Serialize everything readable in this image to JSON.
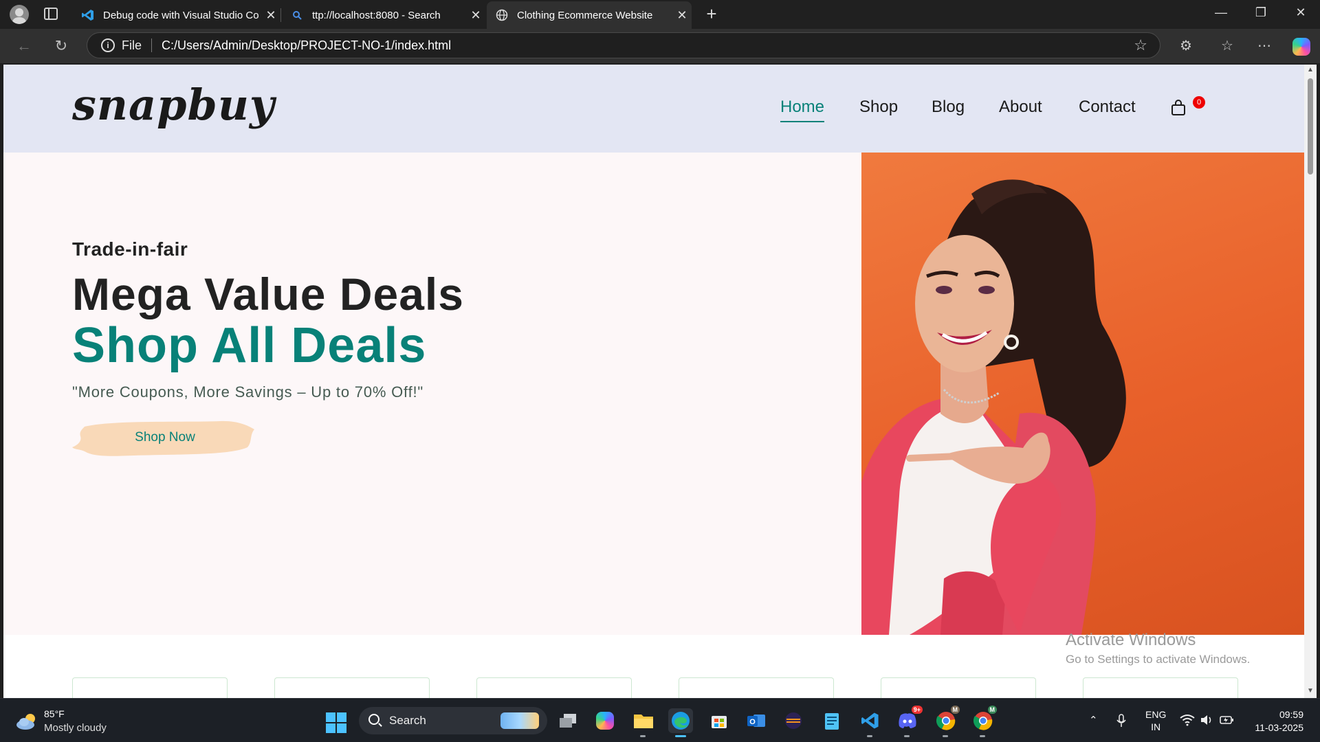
{
  "browser": {
    "tabs": [
      {
        "title": "Debug code with Visual Studio Co",
        "icon": "vscode-icon",
        "active": false
      },
      {
        "title": "ttp://localhost:8080 - Search",
        "icon": "search-icon",
        "active": false
      },
      {
        "title": "Clothing Ecommerce Website",
        "icon": "globe-icon",
        "active": true
      }
    ],
    "address": {
      "scheme_label": "File",
      "url": "C:/Users/Admin/Desktop/PROJECT-NO-1/index.html"
    }
  },
  "site": {
    "logo": "snapbuy",
    "nav": [
      {
        "label": "Home",
        "active": true
      },
      {
        "label": "Shop",
        "active": false
      },
      {
        "label": "Blog",
        "active": false
      },
      {
        "label": "About",
        "active": false
      },
      {
        "label": "Contact",
        "active": false
      }
    ],
    "cart_count": "0",
    "accent_color": "#088178",
    "hero": {
      "eyebrow": "Trade-in-fair",
      "headline": "Mega Value Deals",
      "highlight": "Shop All Deals",
      "tagline": "\"More Coupons, More Savings – Up to 70% Off!\"",
      "button_label": "Shop Now"
    }
  },
  "watermark": {
    "line1": "Activate Windows",
    "line2": "Go to Settings to activate Windows."
  },
  "taskbar": {
    "weather": {
      "temp": "85°F",
      "desc": "Mostly cloudy"
    },
    "search_label": "Search",
    "language": {
      "line1": "ENG",
      "line2": "IN"
    },
    "clock": {
      "time": "09:59",
      "date": "11-03-2025"
    },
    "badges": {
      "discord": "9+",
      "chrome_profile": "M"
    }
  }
}
